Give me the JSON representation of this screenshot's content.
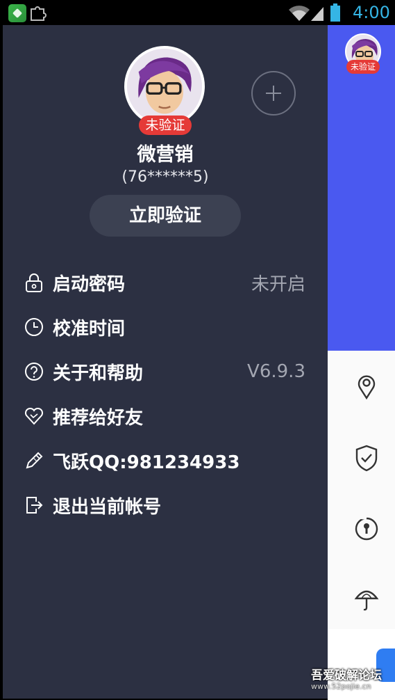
{
  "status_bar": {
    "time": "4:00",
    "icons": [
      "app-icon",
      "puzzle-icon",
      "wifi-icon",
      "signal-icon",
      "battery-icon"
    ],
    "time_color": "#35b5e5"
  },
  "drawer": {
    "background": "#2c3042",
    "profile": {
      "badge": "未验证",
      "name": "微营销",
      "account": "(76******5)",
      "verify_button": "立即验证",
      "add_icon": "plus-circle-icon"
    },
    "menu": [
      {
        "icon": "lock-icon",
        "label": "启动密码",
        "value": "未开启"
      },
      {
        "icon": "clock-icon",
        "label": "校准时间",
        "value": ""
      },
      {
        "icon": "help-circle-icon",
        "label": "关于和帮助",
        "value": "V6.9.3"
      },
      {
        "icon": "heart-icon",
        "label": "推荐给好友",
        "value": ""
      },
      {
        "icon": "pencil-icon",
        "label": "飞跃QQ:981234933",
        "value": ""
      },
      {
        "icon": "logout-icon",
        "label": "退出当前帐号",
        "value": ""
      }
    ]
  },
  "main_peek": {
    "header_color": "#4a59f0",
    "avatar_badge": "未验证",
    "side_icons": [
      "location-pin-icon",
      "shield-check-icon",
      "keyhole-icon",
      "umbrella-icon"
    ]
  },
  "watermark": {
    "line1": "吾爱破解论坛",
    "line2": "www.52pojie.cn"
  },
  "accent_colors": {
    "badge_red": "#e53a37",
    "blue": "#4a59f0"
  }
}
